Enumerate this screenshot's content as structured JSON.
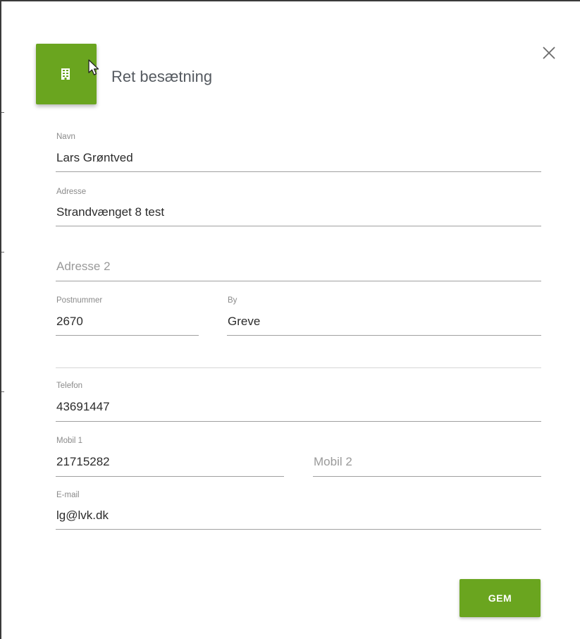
{
  "dialog": {
    "title": "Ret besætning",
    "header_icon": "building-icon",
    "close_icon": "close-icon",
    "accent_color": "#6aa51f"
  },
  "form": {
    "navn": {
      "label": "Navn",
      "value": "Lars Grøntved"
    },
    "adresse": {
      "label": "Adresse",
      "value": "Strandvænget 8 test"
    },
    "adresse2": {
      "placeholder": "Adresse 2"
    },
    "postnummer": {
      "label": "Postnummer",
      "value": "2670"
    },
    "by": {
      "label": "By",
      "value": "Greve"
    },
    "telefon": {
      "label": "Telefon",
      "value": "43691447"
    },
    "mobil1": {
      "label": "Mobil 1",
      "value": "21715282"
    },
    "mobil2": {
      "placeholder": "Mobil 2"
    },
    "email": {
      "label": "E-mail",
      "value": "lg@lvk.dk"
    }
  },
  "actions": {
    "save_label": "GEM"
  }
}
